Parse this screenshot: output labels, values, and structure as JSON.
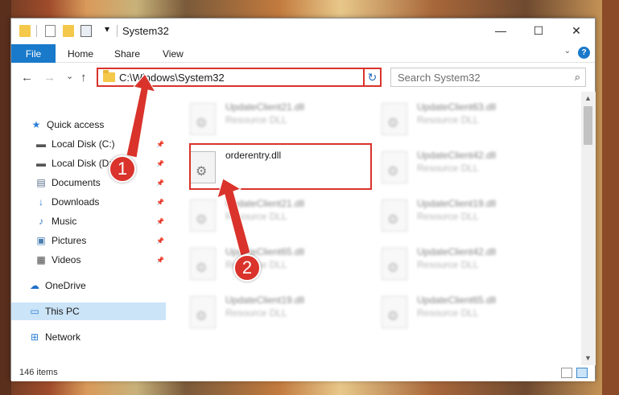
{
  "window": {
    "title": "System32",
    "controls": {
      "minimize": "—",
      "maximize": "☐",
      "close": "✕"
    }
  },
  "quick_access_toolbar": {
    "dropdown": "▾"
  },
  "ribbon": {
    "tabs": [
      "File",
      "Home",
      "Share",
      "View"
    ],
    "collapse": "⌄",
    "help": "?"
  },
  "nav_buttons": {
    "back": "←",
    "forward": "→",
    "recent": "⌄",
    "up": "↑"
  },
  "address_bar": {
    "path": "C:\\Windows\\System32",
    "dropdown": "⌄",
    "refresh": "↻"
  },
  "search": {
    "placeholder": "Search System32",
    "icon": "⌕"
  },
  "nav_pane": {
    "items": [
      {
        "label": "Quick access",
        "icon": "star-icon",
        "glyph": "★",
        "color": "#2a7fd4",
        "pinned": false
      },
      {
        "label": "Local Disk (C:)",
        "icon": "drive-icon",
        "glyph": "▬",
        "color": "#555555",
        "pinned": true
      },
      {
        "label": "Local Disk (D:)",
        "icon": "drive-icon",
        "glyph": "▬",
        "color": "#555555",
        "pinned": true
      },
      {
        "label": "Documents",
        "icon": "documents-icon",
        "glyph": "▤",
        "color": "#5a6f8a",
        "pinned": true
      },
      {
        "label": "Downloads",
        "icon": "downloads-icon",
        "glyph": "↓",
        "color": "#2a7fd4",
        "pinned": true
      },
      {
        "label": "Music",
        "icon": "music-icon",
        "glyph": "♪",
        "color": "#2a7fd4",
        "pinned": true
      },
      {
        "label": "Pictures",
        "icon": "pictures-icon",
        "glyph": "▣",
        "color": "#4a7fb0",
        "pinned": true
      },
      {
        "label": "Videos",
        "icon": "videos-icon",
        "glyph": "▦",
        "color": "#444444",
        "pinned": true
      },
      {
        "label": "OneDrive",
        "icon": "onedrive-icon",
        "glyph": "☁",
        "color": "#1e6fc9",
        "pinned": false
      },
      {
        "label": "This PC",
        "icon": "this-pc-icon",
        "glyph": "▭",
        "color": "#2a7fd4",
        "pinned": false,
        "selected": true
      },
      {
        "label": "Network",
        "icon": "network-icon",
        "glyph": "⊞",
        "color": "#2a7fd4",
        "pinned": false
      }
    ],
    "pin_glyph": "📌"
  },
  "files": [
    {
      "name": "UpdateClient21.dll",
      "type": "Resource DLL",
      "blurred": true
    },
    {
      "name": "UpdateClient63.dll",
      "type": "Resource DLL",
      "blurred": true
    },
    {
      "name": "orderentry.dll",
      "type": "",
      "blurred": false
    },
    {
      "name": "UpdateClient42.dll",
      "type": "Resource DLL",
      "blurred": true
    },
    {
      "name": "UpdateClient21.dll",
      "type": "Resource DLL",
      "blurred": true
    },
    {
      "name": "UpdateClient19.dll",
      "type": "Resource DLL",
      "blurred": true
    },
    {
      "name": "UpdateClient65.dll",
      "type": "Resource DLL",
      "blurred": true
    },
    {
      "name": "UpdateClient42.dll",
      "type": "Resource DLL",
      "blurred": true
    },
    {
      "name": "UpdateClient19.dll",
      "type": "Resource DLL",
      "blurred": true
    },
    {
      "name": "UpdateClient65.dll",
      "type": "Resource DLL",
      "blurred": true
    }
  ],
  "scrollbar": {
    "up": "▲",
    "down": "▼"
  },
  "status": {
    "item_count": "146 items"
  },
  "annotations": {
    "marker_1": "1",
    "marker_2": "2",
    "color": "#d9332b"
  }
}
